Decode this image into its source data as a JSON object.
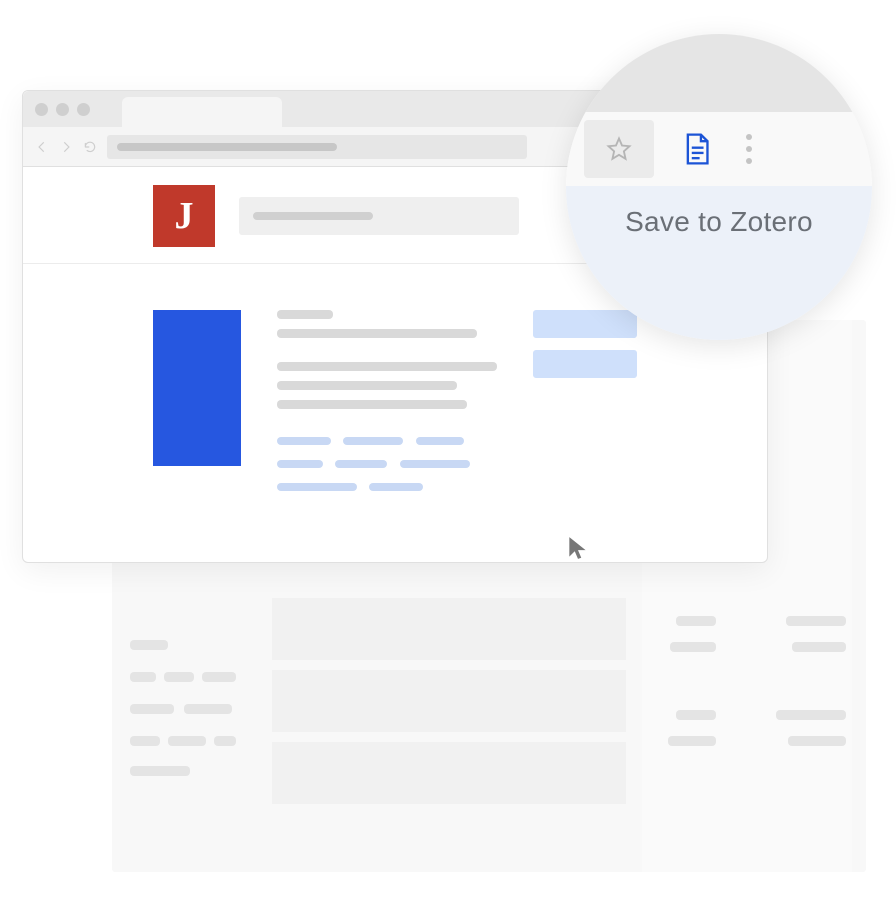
{
  "tooltip": {
    "label": "Save to Zotero"
  },
  "logo": {
    "letter": "J"
  },
  "colors": {
    "articleThumb": "#2657e0",
    "logoBg": "#c0392b",
    "actionBtn": "#cfe0fb",
    "connectorIcon": "#1c54d6"
  }
}
